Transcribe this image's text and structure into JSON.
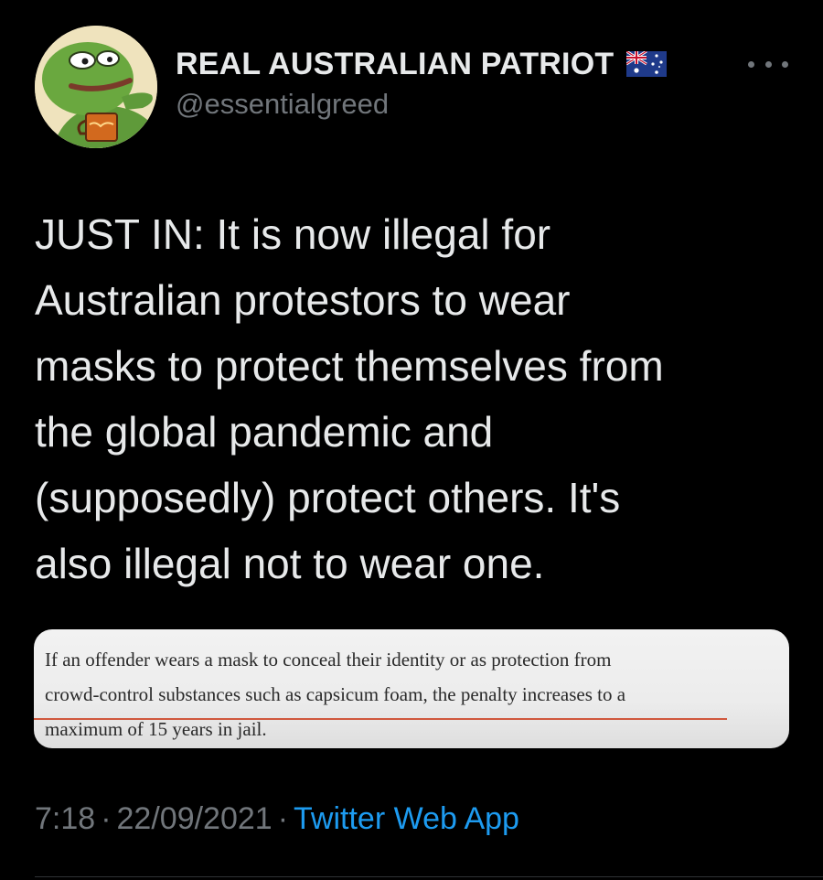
{
  "author": {
    "display_name": "REAL AUSTRALIAN PATRIOT",
    "handle": "@essentialgreed",
    "flag_icon": "australia-flag-icon",
    "avatar_icon": "frog-avatar-icon"
  },
  "tweet": {
    "text": "JUST IN: It is now illegal for\nAustralian protestors to wear\nmasks to protect themselves from\nthe global pandemic and\n(supposedly) protect others. It's\nalso illegal not to wear one.",
    "quote_image_text": "If an offender wears a mask to conceal their identity or as protection from\ncrowd-control substances such as capsicum foam, the penalty increases to a\nmaximum of 15 years in jail.",
    "time": "7:18",
    "date": "22/09/2021",
    "separator": "·",
    "source": "Twitter Web App"
  },
  "colors": {
    "background": "#000000",
    "primary_text": "#e7e9ea",
    "secondary_text": "#71767b",
    "link": "#1d9bf0",
    "highlight_underline": "#d0583e"
  }
}
